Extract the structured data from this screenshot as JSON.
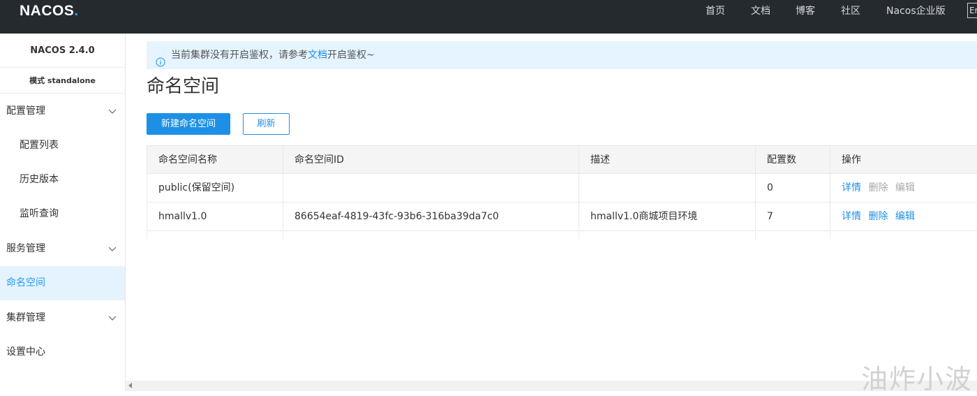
{
  "header": {
    "logo": {
      "text_before": "NAC",
      "text_o": "O",
      "text_after": "S",
      "dot": "."
    },
    "nav": [
      "首页",
      "文档",
      "博客",
      "社区",
      "Nacos企业版"
    ],
    "lang_button": "En"
  },
  "sidebar": {
    "version": "NACOS 2.4.0",
    "mode": "模式 standalone",
    "items": [
      {
        "label": "配置管理",
        "type": "group",
        "expanded": true,
        "icon": "chevron-down-icon"
      },
      {
        "label": "配置列表",
        "type": "child"
      },
      {
        "label": "历史版本",
        "type": "child"
      },
      {
        "label": "监听查询",
        "type": "child"
      },
      {
        "label": "服务管理",
        "type": "group",
        "icon": "chevron-down-icon"
      },
      {
        "label": "命名空间",
        "type": "group",
        "active": true
      },
      {
        "label": "集群管理",
        "type": "group",
        "icon": "chevron-down-icon"
      },
      {
        "label": "设置中心",
        "type": "group"
      }
    ]
  },
  "notice": {
    "icon": "info-icon",
    "prefix": "当前集群没有开启鉴权，请参考",
    "link": "文档",
    "suffix": "开启鉴权~"
  },
  "page": {
    "title": "命名空间",
    "create_button": "新建命名空间",
    "refresh_button": "刷新"
  },
  "table": {
    "columns": [
      "命名空间名称",
      "命名空间ID",
      "描述",
      "配置数",
      "操作"
    ],
    "rows": [
      {
        "name": "public(保留空间)",
        "id": "",
        "desc": "",
        "count": "0",
        "actions": {
          "detail": "详情",
          "delete": "删除",
          "edit": "编辑"
        },
        "actions_enabled": false
      },
      {
        "name": "hmallv1.0",
        "id": "86654eaf-4819-43fc-93b6-316ba39da7c0",
        "desc": "hmallv1.0商城项目环境",
        "count": "7",
        "actions": {
          "detail": "详情",
          "delete": "删除",
          "edit": "编辑"
        },
        "actions_enabled": true
      }
    ]
  },
  "watermark": "油炸小波",
  "colors": {
    "header_bg": "#252a2f",
    "accent": "#1d90e6",
    "active_bg": "#e5f3ff",
    "notice_bg": "#e6f4ff"
  }
}
